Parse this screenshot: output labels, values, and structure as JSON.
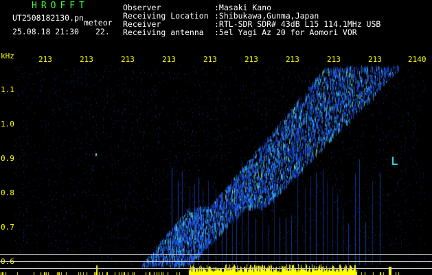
{
  "header": {
    "logo": "HROFFT",
    "filename": "UT2508182130.pn",
    "mode": "meteor",
    "datetime": "25.08.18 21:30",
    "time_tail": "22.",
    "fields": [
      {
        "label": "Observer",
        "value": ":Masaki Kano"
      },
      {
        "label": "Receiving Location",
        "value": ":Shibukawa,Gunma,Japan"
      },
      {
        "label": "Receiver",
        "value": ":RTL-SDR SDR# 43dB L15 114.1MHz USB"
      },
      {
        "label": "Receiving antenna",
        "value": ":5el Yagi Az 20 for Aomori VOR"
      }
    ]
  },
  "axes": {
    "y_unit": "kHz",
    "y_ticks": [
      "1.1",
      "1.0",
      "0.9",
      "0.8",
      "0.7",
      "0.6"
    ],
    "x_ticks": [
      "213",
      "213",
      "213",
      "213",
      "213",
      "213",
      "213",
      "213",
      "213",
      "2140"
    ]
  },
  "colors": {
    "text_green": "#39ff39",
    "text_white": "#ffffff",
    "axis_yellow": "#ffff00",
    "background": "#000000",
    "signal_blue": "#1e5cff",
    "signal_cyan": "#40e0ff",
    "signal_green": "#a0ff80"
  }
}
